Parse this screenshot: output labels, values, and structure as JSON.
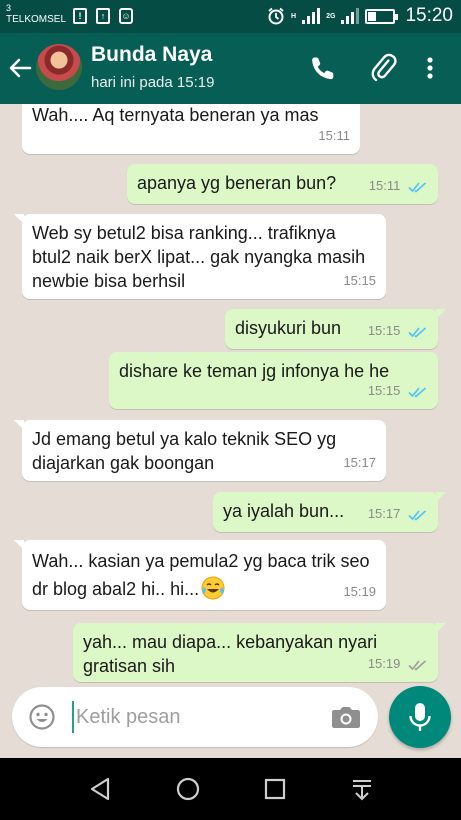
{
  "statusbar": {
    "carrier_num": "3",
    "carrier": "TELKOMSEL",
    "net_h": "H",
    "net_2g": "2G",
    "time": "15:20"
  },
  "header": {
    "name": "Bunda Naya",
    "status": "hari ini pada 15:19"
  },
  "messages": [
    {
      "dir": "in",
      "text": "Wah.... Aq ternyata beneran ya mas",
      "time": "15:11"
    },
    {
      "dir": "out",
      "text": "apanya yg beneran bun?",
      "time": "15:11"
    },
    {
      "dir": "in",
      "text": "Web sy betul2 bisa ranking... trafiknya btul2 naik berX lipat... gak nyangka masih newbie bisa berhsil",
      "time": "15:15"
    },
    {
      "dir": "out",
      "text": "disyukuri bun",
      "time": "15:15"
    },
    {
      "dir": "out",
      "text": "dishare ke teman jg infonya he he",
      "time": "15:15"
    },
    {
      "dir": "in",
      "text": "Jd emang betul ya kalo teknik SEO yg diajarkan gak boongan",
      "time": "15:17"
    },
    {
      "dir": "out",
      "text": "ya iyalah bun...",
      "time": "15:17"
    },
    {
      "dir": "in",
      "text": "Wah... kasian ya pemula2 yg baca trik seo dr blog abal2 hi.. hi...",
      "time": "15:19"
    },
    {
      "dir": "out",
      "text": "yah... mau diapa... kebanyakan nyari gratisan sih",
      "time": "15:19"
    }
  ],
  "input": {
    "placeholder": "Ketik pesan"
  },
  "colors": {
    "header": "#075e54",
    "statusbar": "#054d44",
    "outgoing_bubble": "#dcf8c6",
    "incoming_bubble": "#ffffff",
    "read_ticks": "#4fc3f7",
    "mic_button": "#00897b"
  },
  "icons": [
    "back-arrow-icon",
    "phone-icon",
    "paperclip-icon",
    "more-vert-icon",
    "emoji-icon",
    "camera-icon",
    "mic-icon",
    "nav-back-icon",
    "nav-home-icon",
    "nav-recents-icon",
    "nav-notifications-icon",
    "tears-of-joy-emoji-icon"
  ]
}
